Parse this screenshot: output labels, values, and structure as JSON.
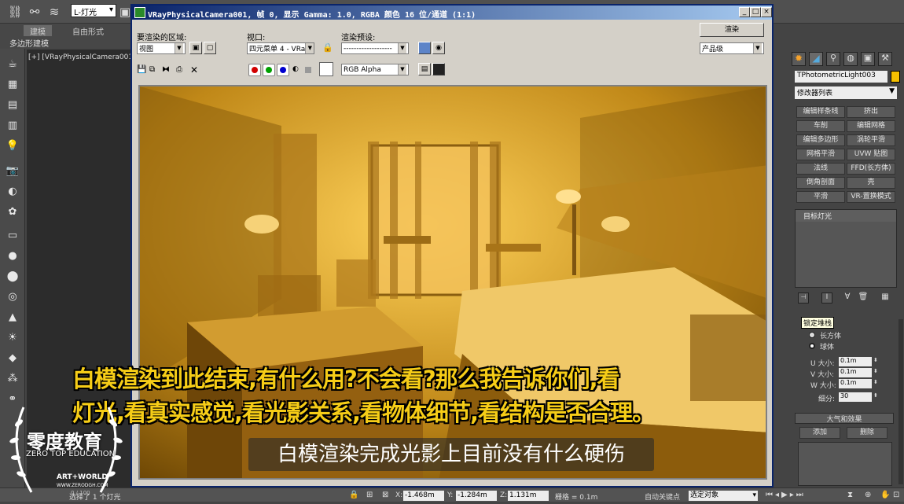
{
  "top_toolbar": {
    "selection_set": "L-灯光"
  },
  "ribbon": {
    "tabs": [
      "建模",
      "自由形式"
    ],
    "sub_label": "多边形建模"
  },
  "viewport": {
    "label": "[+] [VRayPhysicalCamera001] ["
  },
  "render_window": {
    "title": "VRayPhysicalCamera001, 帧 0, 显示 Gamma: 1.0, RGBA 颜色 16 位/通道 (1:1)",
    "area_label": "要渲染的区域:",
    "area_value": "视图",
    "viewport_label": "视口:",
    "viewport_value": "四元菜单 4 - VRa",
    "preset_label": "渲染预设:",
    "preset_value": "-------------------",
    "render_button": "渲染",
    "quality_value": "产品级",
    "channel_value": "RGB Alpha"
  },
  "subtitles": {
    "line1": "白模渲染到此结束,有什么用?不会看?那么我告诉你们,看",
    "line2": "灯光,看真实感觉,看光影关系,看物体细节,看结构是否合理。",
    "caption": "白模渲染完成光影上目前没有什么硬伤"
  },
  "right_panel": {
    "object_name": "TPhotometricLight003",
    "modifier_list": "修改器列表",
    "modifier_buttons": [
      [
        "编辑样条线",
        "挤出"
      ],
      [
        "车削",
        "编辑网格"
      ],
      [
        "编辑多边形",
        "涡轮平滑"
      ],
      [
        "网格平滑",
        "UVW 贴图"
      ],
      [
        "法线",
        "FFD(长方体)"
      ],
      [
        "倒角剖面",
        "壳"
      ],
      [
        "平滑",
        "VR-置换模式"
      ]
    ],
    "stack_item": "目标灯光",
    "tooltip": "锁定堆栈",
    "shape_options": [
      "长方体",
      "球体"
    ],
    "u_label": "U 大小:",
    "u_value": "0.1m",
    "v_label": "V 大小:",
    "v_value": "0.1m",
    "w_label": "W 大小:",
    "w_value": "0.1m",
    "segments_label": "细分:",
    "segments_value": "30",
    "atmos_title": "大气和效果",
    "add_button": "添加",
    "delete_button": "删除"
  },
  "status": {
    "selected_text": "选择了 1 个灯光",
    "x_label": "X:",
    "x_value": "-1.468m",
    "y_label": "Y:",
    "y_value": "-1.284m",
    "z_label": "Z:",
    "z_value": "1.131m",
    "grid_text": "栅格 = 0.1m",
    "autokey": "自动关键点",
    "selected_obj": "选定对象",
    "frame_counter": "0 / 100"
  },
  "logo": {
    "main": "零度教育",
    "sub": "ZERO TOP EDUCATION",
    "partner": "ART+WORLD",
    "partner_url": "WWW.ZERODGH.COM"
  }
}
